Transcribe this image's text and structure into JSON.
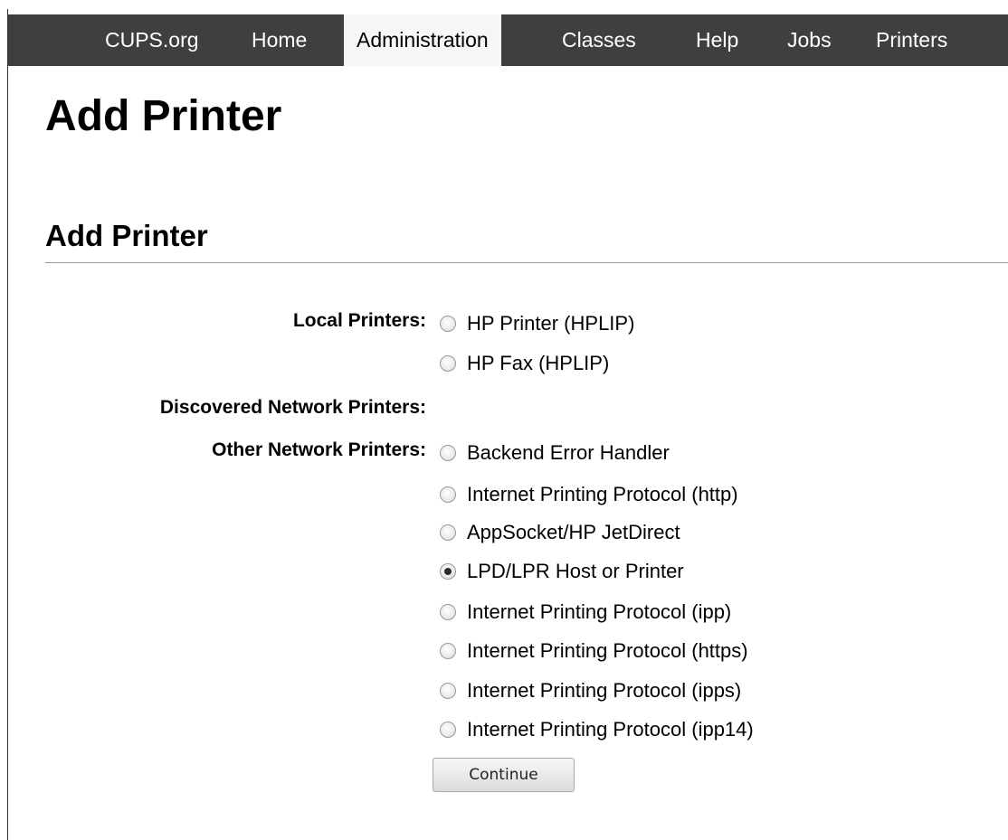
{
  "nav": {
    "items": [
      {
        "label": "CUPS.org",
        "active": false
      },
      {
        "label": "Home",
        "active": false
      },
      {
        "label": "Administration",
        "active": true
      },
      {
        "label": "Classes",
        "active": false
      },
      {
        "label": "Help",
        "active": false
      },
      {
        "label": "Jobs",
        "active": false
      },
      {
        "label": "Printers",
        "active": false
      }
    ]
  },
  "page": {
    "title": "Add Printer",
    "section_title": "Add Printer"
  },
  "form": {
    "local_label": "Local Printers:",
    "local_options": [
      {
        "label": "HP Printer (HPLIP)",
        "checked": false
      },
      {
        "label": "HP Fax (HPLIP)",
        "checked": false
      }
    ],
    "discovered_label": "Discovered Network Printers:",
    "other_label": "Other Network Printers:",
    "other_options": [
      {
        "label": "Backend Error Handler",
        "checked": false
      },
      {
        "label": "Internet Printing Protocol (http)",
        "checked": false
      },
      {
        "label": "AppSocket/HP JetDirect",
        "checked": false
      },
      {
        "label": "LPD/LPR Host or Printer",
        "checked": true
      },
      {
        "label": "Internet Printing Protocol (ipp)",
        "checked": false
      },
      {
        "label": "Internet Printing Protocol (https)",
        "checked": false
      },
      {
        "label": "Internet Printing Protocol (ipps)",
        "checked": false
      },
      {
        "label": "Internet Printing Protocol (ipp14)",
        "checked": false
      }
    ],
    "continue_label": "Continue"
  },
  "colors": {
    "navbar_bg": "#3f3f3f",
    "nav_active_bg": "#f6f6f6"
  }
}
